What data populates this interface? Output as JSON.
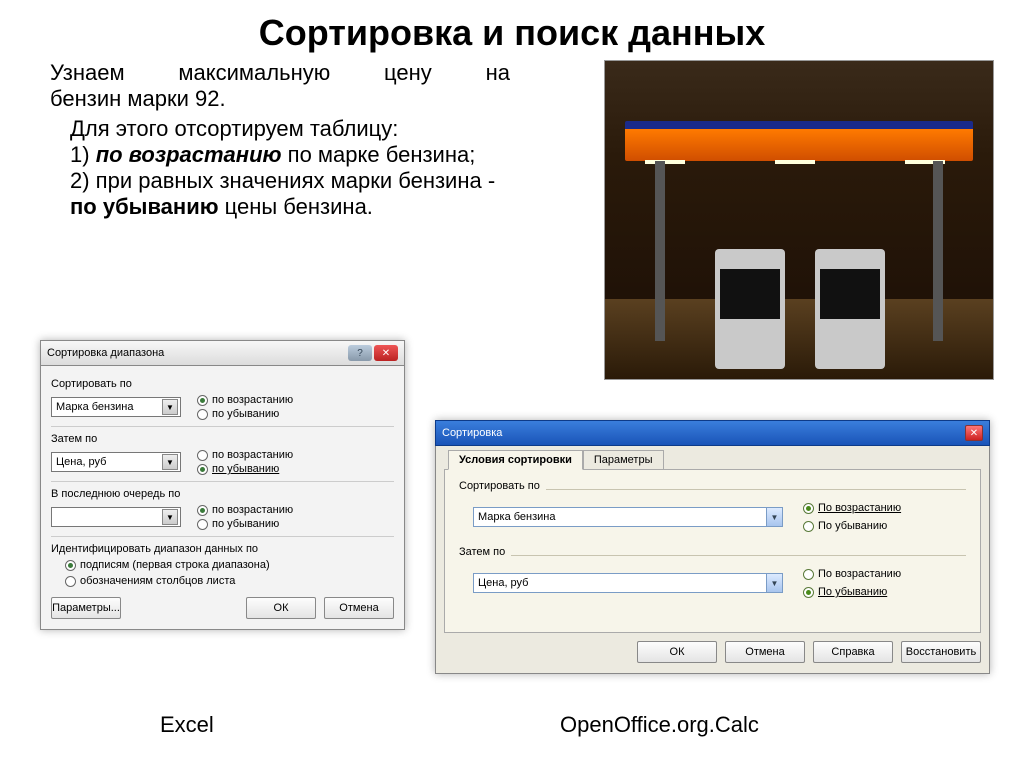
{
  "title": "Сортировка и поиск данных",
  "intro": {
    "line1_words": [
      "Узнаем",
      "максимальную",
      "цену",
      "на"
    ],
    "line2": "бензин марки 92."
  },
  "steps": {
    "lead": "Для этого отсортируем таблицу:",
    "s1_a": "1) ",
    "s1_b": "по возрастанию",
    "s1_c": " по марке бензина;",
    "s2_a": "2) при равных значениях марки бензина - ",
    "s2_b": "по убыванию",
    "s2_c": " цены бензина."
  },
  "excel": {
    "title": "Сортировка диапазона",
    "sort_by": "Сортировать по",
    "then_by": "Затем по",
    "last_by": "В последнюю очередь по",
    "combo1": "Марка бензина",
    "combo2": "Цена, руб",
    "combo3": "",
    "asc": "по возрастанию",
    "desc": "по убыванию",
    "desc_u": "по убыванию",
    "identify": "Идентифицировать диапазон данных по",
    "id_opt1": "подписям (первая строка диапазона)",
    "id_opt2": "обозначениям столбцов листа",
    "params": "Параметры...",
    "ok": "ОК",
    "cancel": "Отмена"
  },
  "oo": {
    "title": "Сортировка",
    "tab1": "Условия сортировки",
    "tab2": "Параметры",
    "sort_by": "Сортировать по",
    "then_by": "Затем по",
    "combo1": "Марка бензина",
    "combo2": "Цена, руб",
    "asc": "По возрастанию",
    "desc": "По убыванию",
    "ok": "ОК",
    "cancel": "Отмена",
    "help": "Справка",
    "restore": "Восстановить"
  },
  "captions": {
    "excel": "Excel",
    "oo": "OpenOffice.org.Calc"
  }
}
